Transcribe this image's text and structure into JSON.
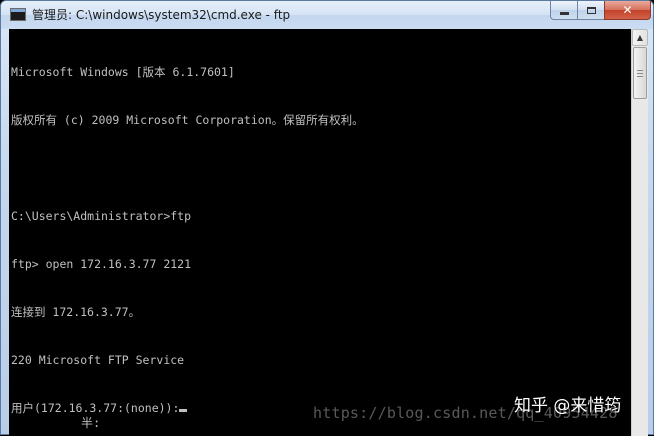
{
  "window": {
    "title": "管理员: C:\\windows\\system32\\cmd.exe - ftp",
    "icon": "cmd-app-icon",
    "controls": {
      "minimize": "minimize-icon",
      "maximize": "maximize-icon",
      "close": "✕"
    }
  },
  "console": {
    "lines": [
      "Microsoft Windows [版本 6.1.7601]",
      "版权所有 (c) 2009 Microsoft Corporation。保留所有权利。",
      "",
      "C:\\Users\\Administrator>ftp",
      "ftp> open 172.16.3.77 2121",
      "连接到 172.16.3.77。",
      "220 Microsoft FTP Service",
      "用户(172.16.3.77:(none)):"
    ],
    "ime_status": "半:",
    "text_color": "#c0c0c0",
    "background_color": "#000000"
  },
  "scrollbar": {
    "up_arrow": "▲"
  },
  "watermarks": {
    "url": "https://blog.csdn.net/qq_40954428",
    "zhihu": "知乎 @来惜筠"
  }
}
